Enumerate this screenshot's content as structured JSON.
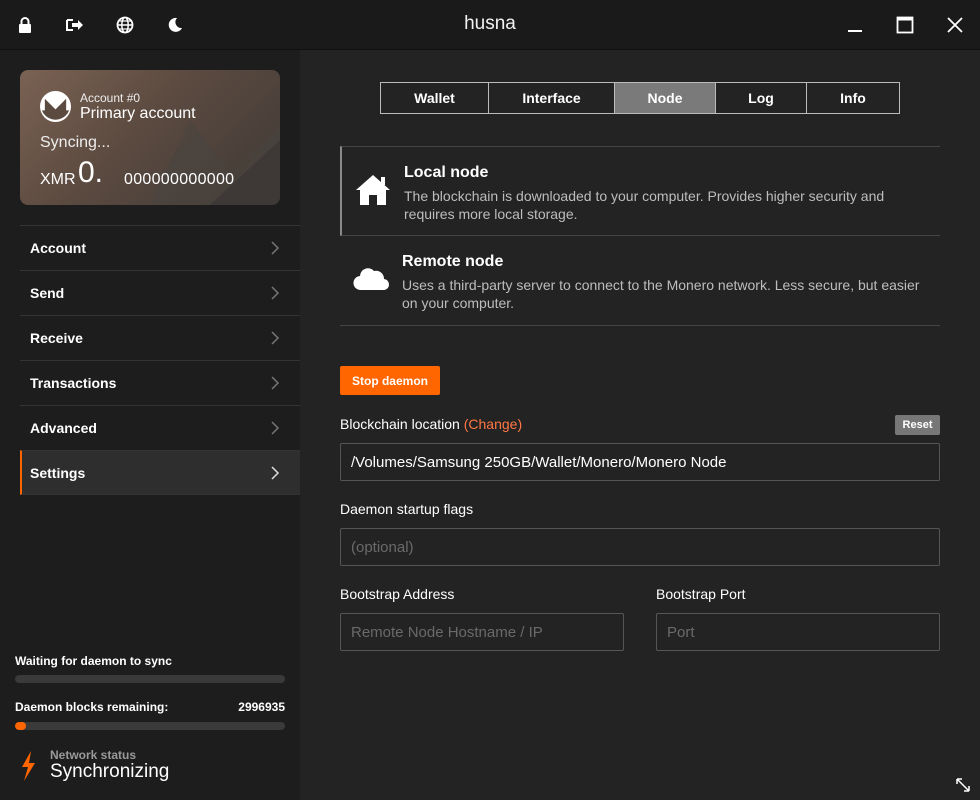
{
  "window": {
    "title": "husna",
    "colors": {
      "accent": "#ff6600",
      "link": "#ff7744",
      "background": "#1d1d1d",
      "panel": "#232323"
    },
    "left_icons": [
      "lock-icon",
      "logout-icon",
      "globe-icon",
      "moon-icon"
    ],
    "right_icons": [
      "minimize-icon",
      "maximize-icon",
      "close-icon"
    ]
  },
  "account_card": {
    "account_number": "Account #0",
    "account_name": "Primary account",
    "status": "Syncing...",
    "currency": "XMR",
    "balance_int": "0.",
    "balance_dec": "000000000000"
  },
  "sidebar": {
    "items": [
      {
        "label": "Account",
        "active": false
      },
      {
        "label": "Send",
        "active": false
      },
      {
        "label": "Receive",
        "active": false
      },
      {
        "label": "Transactions",
        "active": false
      },
      {
        "label": "Advanced",
        "active": false
      },
      {
        "label": "Settings",
        "active": true
      }
    ]
  },
  "sync": {
    "waiting_label": "Waiting for daemon to sync",
    "waiting_progress": 0.0,
    "remaining_label": "Daemon blocks remaining:",
    "remaining_value": "2996935",
    "remaining_progress": 0.04,
    "network_status_label": "Network status",
    "network_status_value": "Synchronizing"
  },
  "tabs": [
    {
      "label": "Wallet",
      "active": false
    },
    {
      "label": "Interface",
      "active": false
    },
    {
      "label": "Node",
      "active": true
    },
    {
      "label": "Log",
      "active": false
    },
    {
      "label": "Info",
      "active": false
    }
  ],
  "node": {
    "local": {
      "title": "Local node",
      "description": "The blockchain is downloaded to your computer. Provides higher security and requires more local storage."
    },
    "remote": {
      "title": "Remote node",
      "description": "Uses a third-party server to connect to the Monero network. Less secure, but easier on your computer."
    },
    "stop_daemon_label": "Stop daemon",
    "blockchain_location_label": "Blockchain location",
    "change_label": "(Change)",
    "reset_label": "Reset",
    "blockchain_location_value": "/Volumes/Samsung 250GB/Wallet/Monero/Monero Node",
    "startup_flags_label": "Daemon startup flags",
    "startup_flags_placeholder": "(optional)",
    "bootstrap_address_label": "Bootstrap Address",
    "bootstrap_address_placeholder": "Remote Node Hostname / IP",
    "bootstrap_port_label": "Bootstrap Port",
    "bootstrap_port_placeholder": "Port"
  }
}
